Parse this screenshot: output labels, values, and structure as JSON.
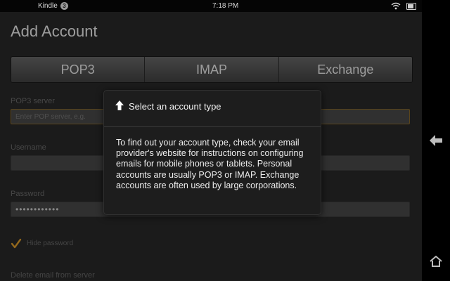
{
  "status_bar": {
    "device": "Kindle",
    "notification_count": "3",
    "time": "7:18 PM"
  },
  "page": {
    "title": "Add Account"
  },
  "tabs": [
    {
      "label": "POP3"
    },
    {
      "label": "IMAP"
    },
    {
      "label": "Exchange"
    }
  ],
  "form": {
    "server_label": "POP3 server",
    "server_placeholder": "Enter POP server, e.g. ",
    "username_label": "Username",
    "password_label": "Password",
    "password_value": "••••••••••••",
    "hide_password_label": "Hide password",
    "delete_label": "Delete email from server"
  },
  "popup": {
    "title": "Select an account type",
    "body": "To find out your account type, check your email provider's website for instructions on configuring emails for mobile phones or tablets. Personal accounts are usually POP3 or IMAP. Exchange accounts are often used by large corporations."
  },
  "colors": {
    "accent": "#e3a02b",
    "background": "#2a2a2a",
    "popup": "#1d1d1d"
  },
  "icons": [
    "wifi-icon",
    "battery-icon",
    "up-arrow-icon",
    "back-arrow-icon",
    "home-icon",
    "checkmark-icon"
  ]
}
